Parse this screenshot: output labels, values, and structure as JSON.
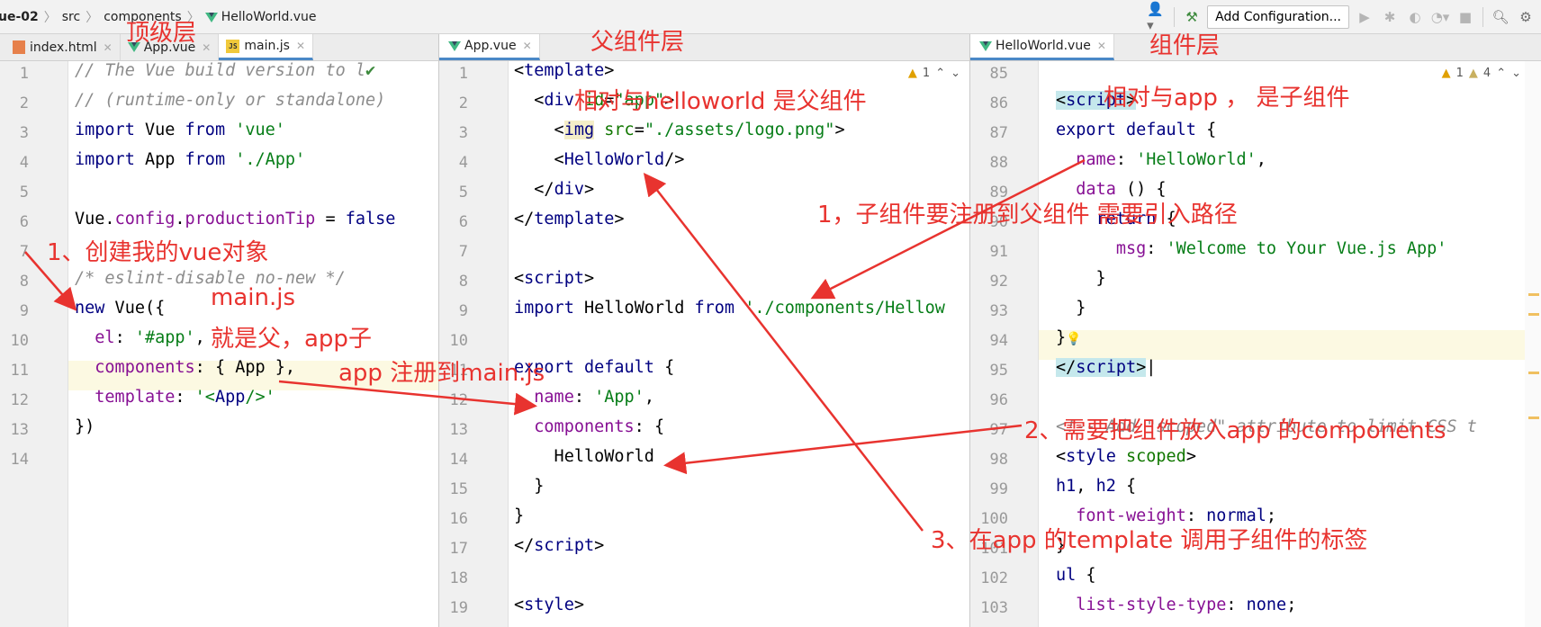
{
  "breadcrumb": [
    "ue-02",
    "src",
    "components",
    "HelloWorld.vue"
  ],
  "toolbar": {
    "add_configuration": "Add Configuration..."
  },
  "left_tabs": [
    {
      "label": "index.html",
      "icon": "html-file-icon"
    },
    {
      "label": "App.vue",
      "icon": "vue-file-icon"
    },
    {
      "label": "main.js",
      "icon": "js-file-icon",
      "active": true
    }
  ],
  "middle_tabs": [
    {
      "label": "App.vue",
      "icon": "vue-file-icon",
      "active": true
    }
  ],
  "right_tabs": [
    {
      "label": "HelloWorld.vue",
      "icon": "vue-file-icon",
      "active": true
    }
  ],
  "warnings": {
    "middle": "1",
    "right_a": "1",
    "right_b": "4"
  },
  "left_code": {
    "lines": [
      "1",
      "2",
      "3",
      "4",
      "5",
      "6",
      "7",
      "8",
      "9",
      "10",
      "11",
      "12",
      "13",
      "14"
    ]
  },
  "middle_code": {
    "lines": [
      "1",
      "2",
      "3",
      "4",
      "5",
      "6",
      "7",
      "8",
      "9",
      "10",
      "11",
      "12",
      "13",
      "14",
      "15",
      "16",
      "17",
      "18",
      "19"
    ]
  },
  "right_code": {
    "lines": [
      "85",
      "86",
      "87",
      "88",
      "89",
      "90",
      "91",
      "92",
      "93",
      "94",
      "95",
      "96",
      "97",
      "98",
      "99",
      "100",
      "101",
      "102",
      "103"
    ]
  },
  "annotations": {
    "top_layer": "顶级层",
    "parent_layer": "父组件层",
    "component_layer": "组件层",
    "relative_parent": "相对与helloworld 是父组件",
    "relative_child": "相对与app ， 是子组件",
    "step1_create": "1、创建我的vue对象",
    "mainjs": "main.js",
    "main_parent": "就是父，app子",
    "app_register": "app 注册到main.js",
    "step1_register": "1，子组件要注册到父组件 需要引入路径",
    "step2": "2、需要把组件放入app 的components",
    "step3": "3、在app 的template 调用子组件的标签"
  },
  "colors": {
    "annotation": "#e8332f",
    "active_tab": "#4a88c7",
    "vue_green": "#41b883"
  }
}
